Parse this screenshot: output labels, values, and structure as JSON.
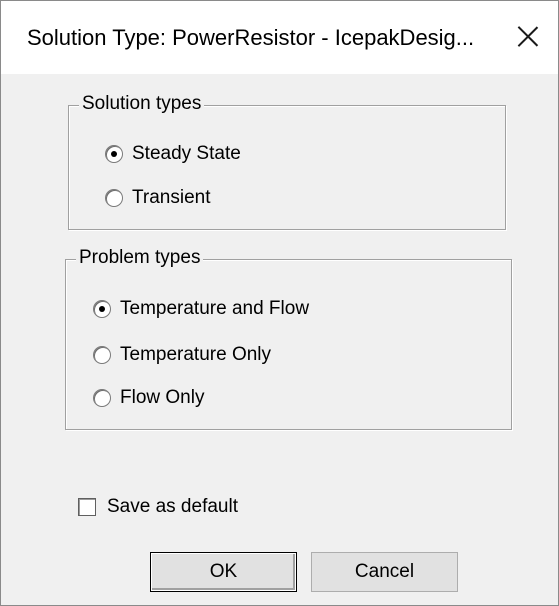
{
  "window": {
    "title": "Solution Type: PowerResistor - IcepakDesig..."
  },
  "solution_types": {
    "legend": "Solution types",
    "options": [
      {
        "label": "Steady State",
        "checked": true
      },
      {
        "label": "Transient",
        "checked": false
      }
    ]
  },
  "problem_types": {
    "legend": "Problem types",
    "options": [
      {
        "label": "Temperature and Flow",
        "checked": true
      },
      {
        "label": "Temperature Only",
        "checked": false
      },
      {
        "label": "Flow Only",
        "checked": false
      }
    ]
  },
  "save_default": {
    "label": "Save as default",
    "checked": false
  },
  "buttons": {
    "ok": "OK",
    "cancel": "Cancel"
  }
}
